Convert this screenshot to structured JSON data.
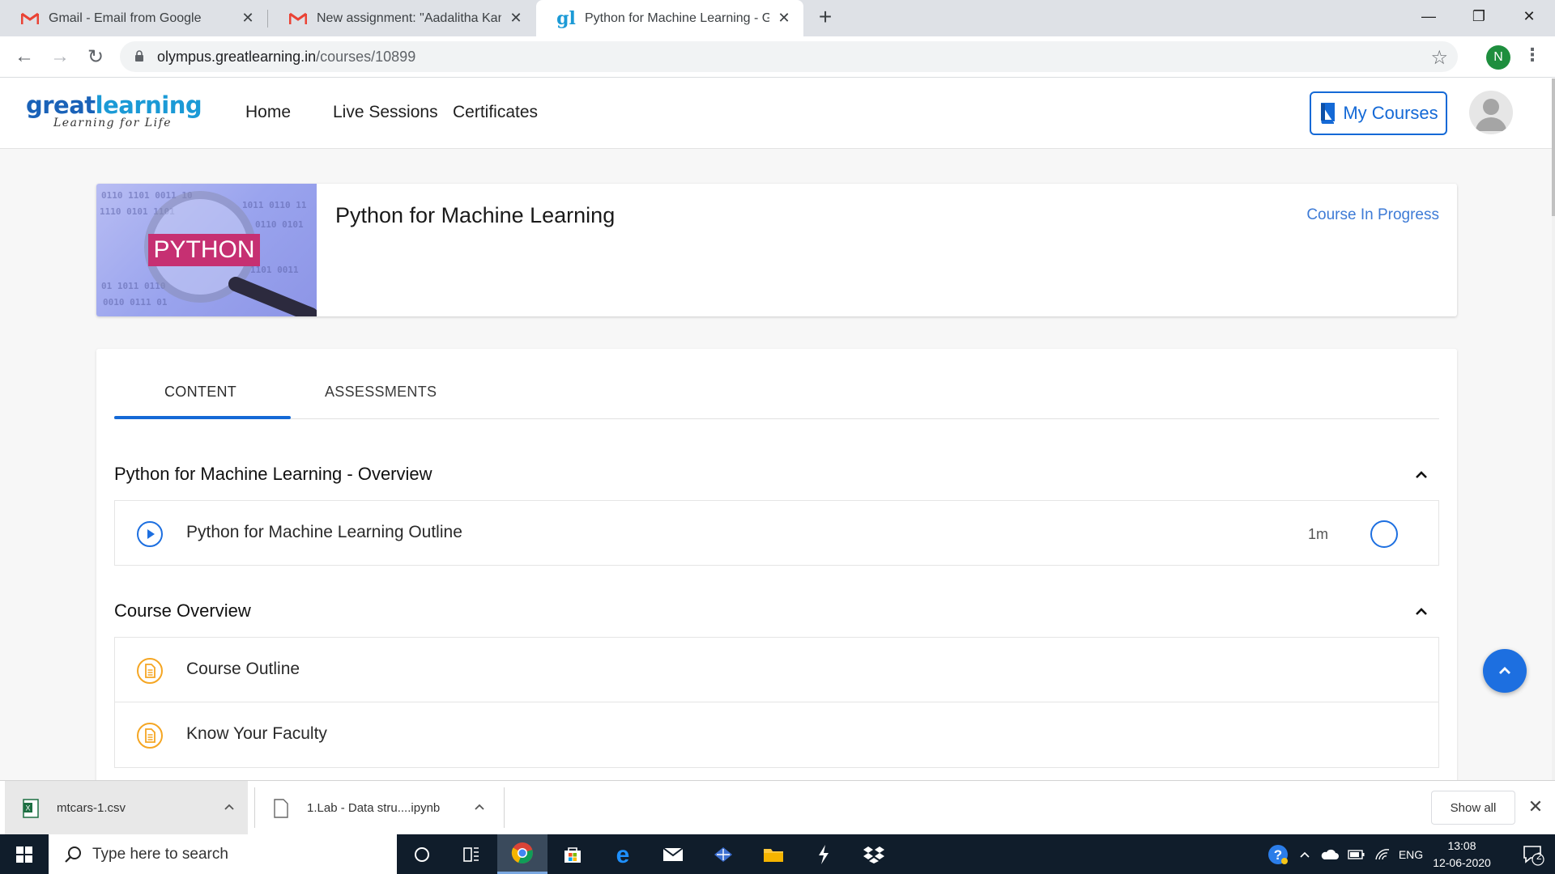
{
  "browser": {
    "tabs": [
      {
        "title": "Gmail - Email from Google",
        "favicon": "gmail-icon",
        "active": false
      },
      {
        "title": "New assignment: \"Aadalitha Kann",
        "favicon": "gmail-icon",
        "active": false
      },
      {
        "title": "Python for Machine Learning - Gr",
        "favicon": "greatlearning-icon",
        "active": true
      }
    ],
    "new_tab_symbol": "+",
    "window_controls": {
      "minimize": "—",
      "restore": "❐",
      "close": "✕"
    },
    "nav": {
      "back": "←",
      "forward": "→",
      "reload": "↻"
    },
    "url_host": "olympus.greatlearning.in",
    "url_path": "/courses/10899",
    "star": "☆",
    "profile_initial": "N",
    "menu": "⋮"
  },
  "site": {
    "logo_brand_main": "great",
    "logo_brand_accent": "learning",
    "logo_tagline": "Learning for Life",
    "nav": [
      "Home",
      "Live Sessions",
      "Certificates"
    ],
    "my_courses_label": "My Courses"
  },
  "course": {
    "thumbnail_text": "PYTHON",
    "title": "Python for Machine Learning",
    "status": "Course In Progress"
  },
  "content_tabs": [
    "CONTENT",
    "ASSESSMENTS"
  ],
  "sections": [
    {
      "title": "Python for Machine Learning - Overview",
      "items": [
        {
          "label": "Python for Machine Learning Outline",
          "duration": "1m",
          "icon": "play-icon"
        }
      ]
    },
    {
      "title": "Course Overview",
      "items": [
        {
          "label": "Course Outline",
          "icon": "document-icon"
        },
        {
          "label": "Know Your Faculty",
          "icon": "document-icon"
        }
      ]
    }
  ],
  "downloads": {
    "items": [
      {
        "name": "mtcars-1.csv",
        "icon": "excel-file-icon"
      },
      {
        "name": "1.Lab - Data stru....ipynb",
        "icon": "file-icon"
      }
    ],
    "show_all_label": "Show all",
    "close_symbol": "✕"
  },
  "taskbar": {
    "search_placeholder": "Type here to search",
    "language": "ENG",
    "time": "13:08",
    "date": "12-06-2020",
    "notification_count": "2"
  },
  "colors": {
    "accent_blue": "#1469d6",
    "status_blue": "#3e7bd6",
    "document_orange": "#f5a623",
    "taskbar_bg": "#101d2b"
  }
}
